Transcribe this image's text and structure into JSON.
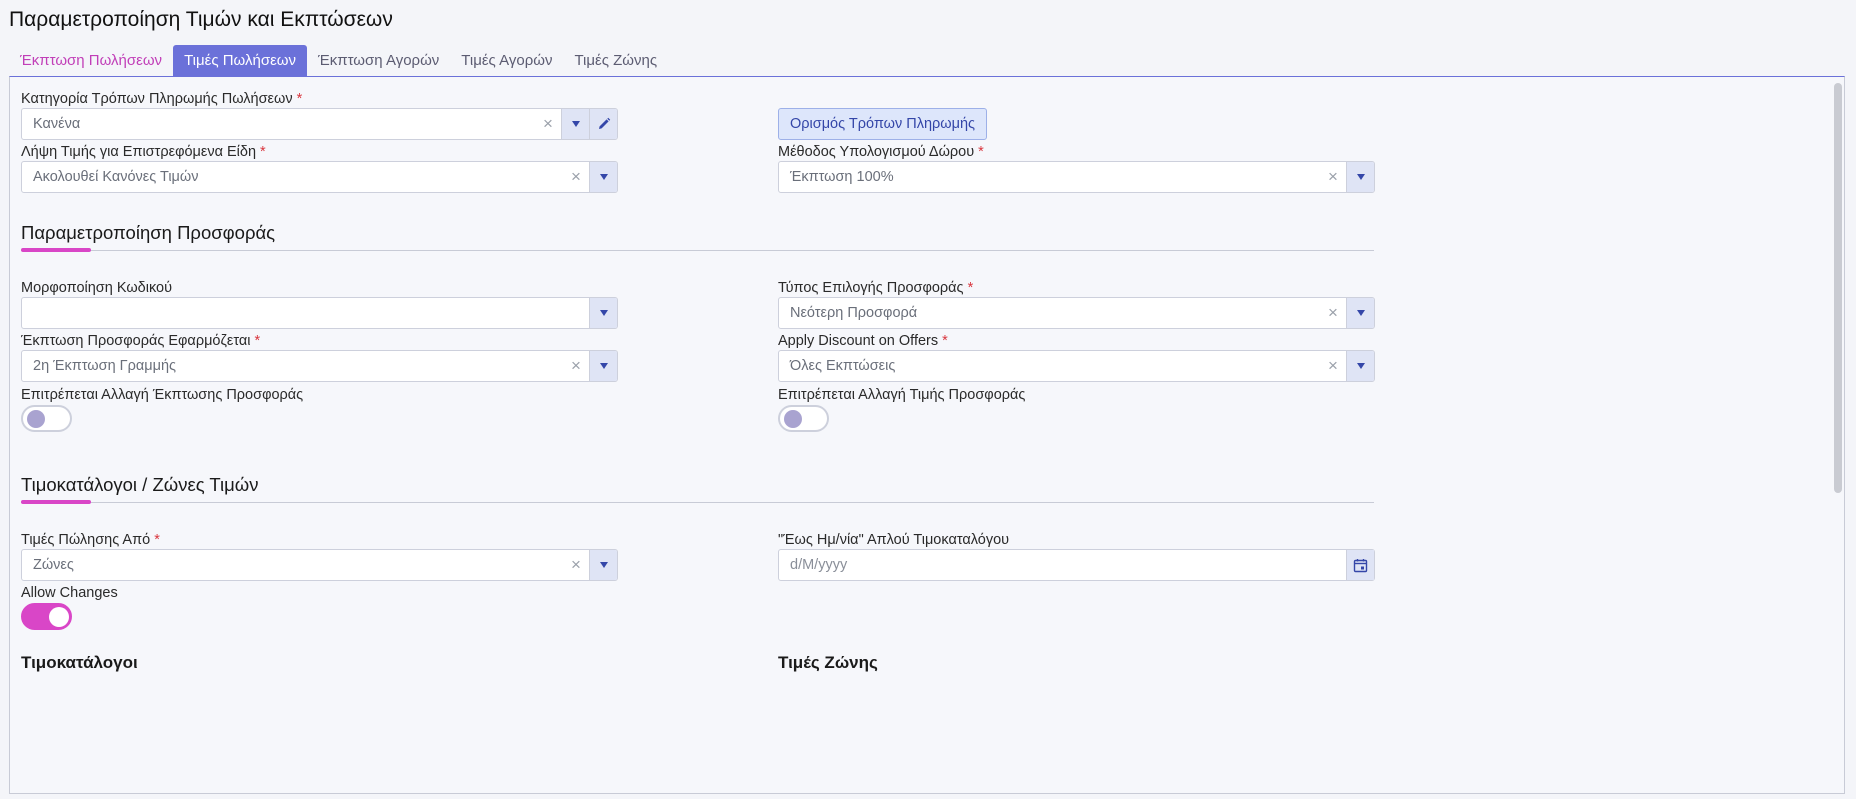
{
  "page": {
    "title": "Παραμετροποίηση Τιμών και Εκπτώσεων"
  },
  "tabs": [
    {
      "label": "Έκπτωση Πωλήσεων"
    },
    {
      "label": "Τιμές Πωλήσεων"
    },
    {
      "label": "Έκπτωση Αγορών"
    },
    {
      "label": "Τιμές Αγορών"
    },
    {
      "label": "Τιμές Ζώνης"
    }
  ],
  "form": {
    "payment_category": {
      "label": "Κατηγορία Τρόπων Πληρωμής Πωλήσεων",
      "required": "*",
      "value": "Κανένα"
    },
    "payment_methods_button": "Ορισμός Τρόπων Πληρωμής",
    "return_price": {
      "label": "Λήψη Τιμής για Επιστρεφόμενα Είδη",
      "required": "*",
      "value": "Ακολουθεί Κανόνες Τιμών"
    },
    "gift_method": {
      "label": "Μέθοδος Υπολογισμού Δώρου",
      "required": "*",
      "value": "Έκπτωση 100%"
    }
  },
  "offer_section": {
    "title": "Παραμετροποίηση Προσφοράς",
    "code_format": {
      "label": "Μορφοποίηση Κωδικού",
      "value": ""
    },
    "offer_selection_type": {
      "label": "Τύπος Επιλογής Προσφοράς",
      "required": "*",
      "value": "Νεότερη Προσφορά"
    },
    "offer_discount_applied": {
      "label": "Έκπτωση Προσφοράς Εφαρμόζεται",
      "required": "*",
      "value": "2η Έκπτωση Γραμμής"
    },
    "apply_discount_offers": {
      "label": "Apply Discount on Offers",
      "required": "*",
      "value": "Όλες Εκπτώσεις"
    },
    "allow_discount_change": {
      "label": "Επιτρέπεται Αλλαγή Έκπτωσης Προσφοράς",
      "on": false
    },
    "allow_price_change": {
      "label": "Επιτρέπεται Αλλαγή Τιμής Προσφοράς",
      "on": false
    }
  },
  "pricelist_section": {
    "title": "Τιμοκατάλογοι / Ζώνες Τιμών",
    "sale_prices_from": {
      "label": "Τιμές Πώλησης Από",
      "required": "*",
      "value": "Ζώνες"
    },
    "until_date": {
      "label": "\"Έως Ημ/νία\" Απλού Τιμοκαταλόγου",
      "placeholder": "d/M/yyyy"
    },
    "allow_changes": {
      "label": "Allow Changes",
      "on": true
    },
    "pricelists_title": "Τιμοκατάλογοι",
    "zone_prices_title": "Τιμές Ζώνης"
  },
  "colors": {
    "accent": "#6b71d9",
    "pink": "#d946c7",
    "required": "#d9363e"
  }
}
